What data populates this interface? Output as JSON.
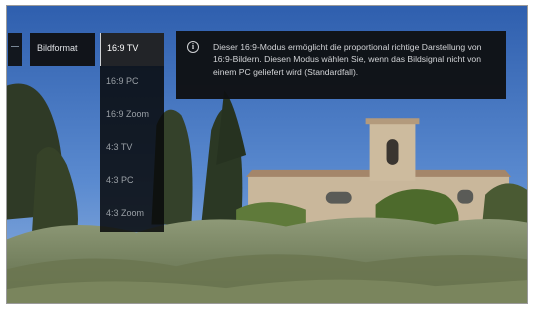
{
  "menu": {
    "category_label": "Bildformat",
    "options": [
      {
        "label": "16:9 TV",
        "selected": true
      },
      {
        "label": "16:9 PC",
        "selected": false
      },
      {
        "label": "16:9 Zoom",
        "selected": false
      },
      {
        "label": "4:3 TV",
        "selected": false
      },
      {
        "label": "4:3 PC",
        "selected": false
      },
      {
        "label": "4:3 Zoom",
        "selected": false
      }
    ]
  },
  "tooltip": {
    "icon": "info-icon",
    "text": "Dieser 16:9-Modus ermöglicht die proportional richtige Darstellung von 16:9-Bildern. Diesen Modus wählen Sie, wenn das Bildsignal nicht von einem PC geliefert wird (Standardfall)."
  },
  "colors": {
    "sky": "#3f6fb8",
    "menu_background": "#0f1012",
    "selected_item": "#222428"
  }
}
